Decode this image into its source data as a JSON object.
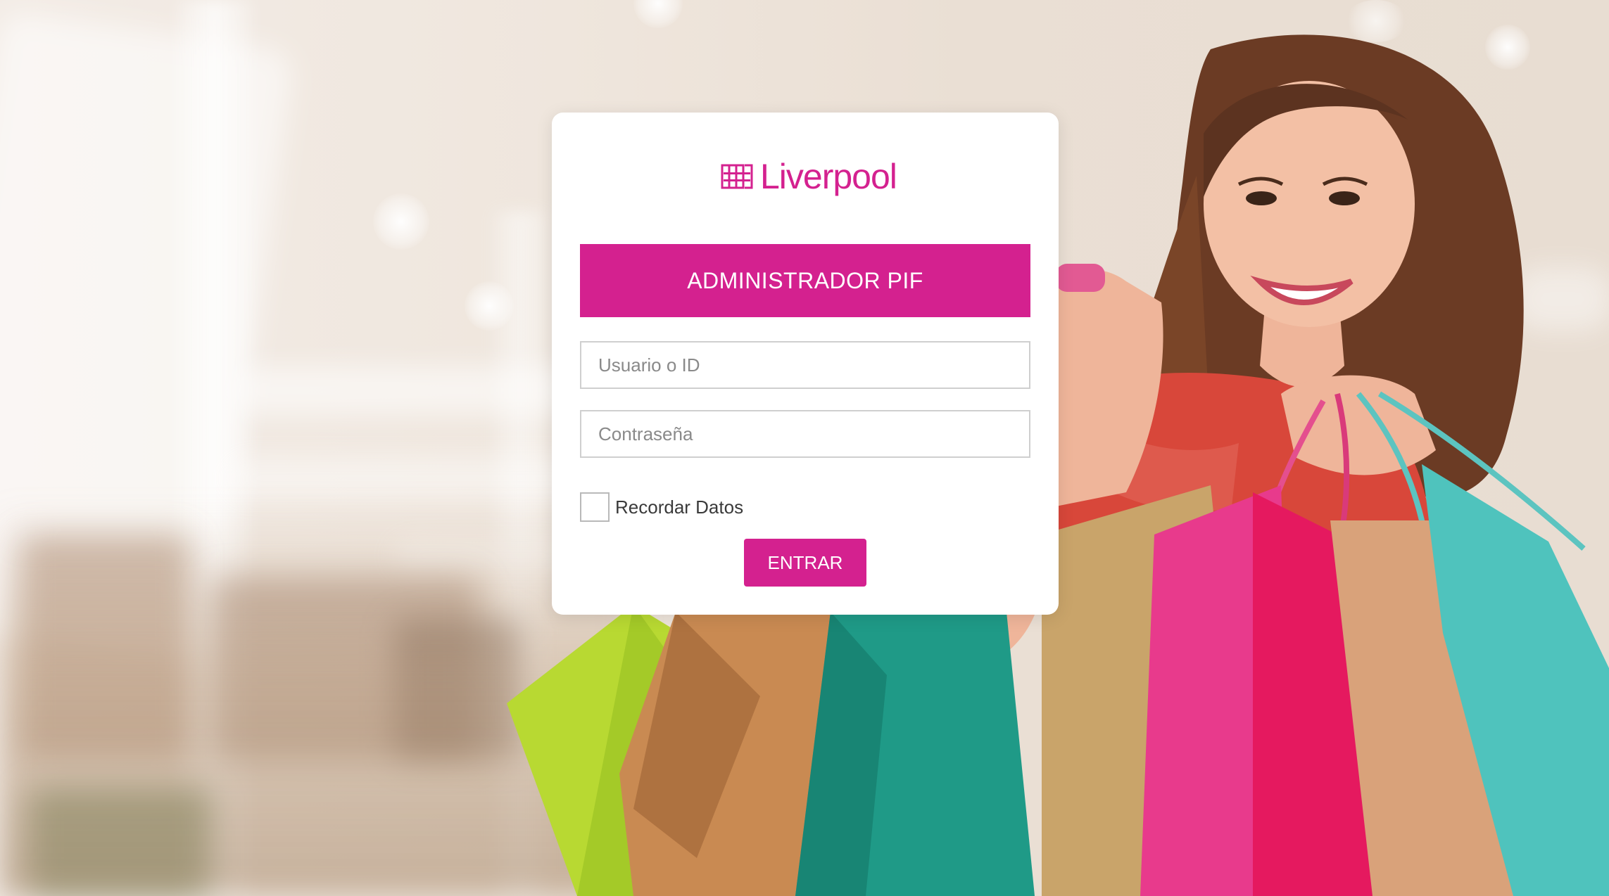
{
  "brand": {
    "name": "Liverpool",
    "color": "#d4218f"
  },
  "login": {
    "title": "ADMINISTRADOR PIF",
    "username_placeholder": "Usuario o ID",
    "username_value": "",
    "password_placeholder": "Contraseña",
    "password_value": "",
    "remember_label": "Recordar Datos",
    "remember_checked": false,
    "submit_label": "ENTRAR"
  },
  "background": {
    "description_icon": "shopping-woman-photo"
  }
}
